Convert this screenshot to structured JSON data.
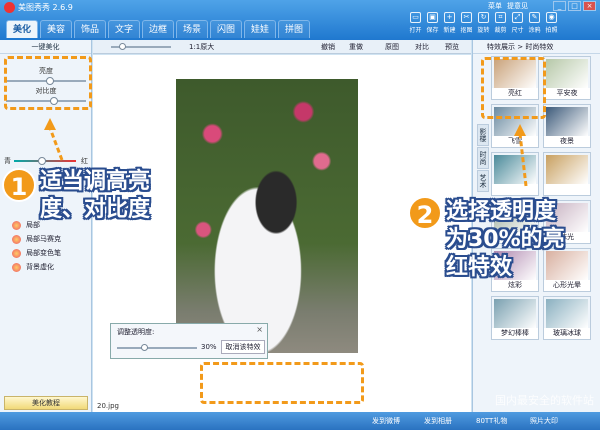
{
  "app": {
    "title": "美图秀秀 2.6.9"
  },
  "top_menu": [
    "菜单",
    "提意见"
  ],
  "window_buttons": [
    "_",
    "□",
    "×"
  ],
  "tabs": [
    "美化",
    "美容",
    "饰品",
    "文字",
    "边框",
    "场景",
    "闪图",
    "娃娃",
    "拼图"
  ],
  "active_tab": "美化",
  "tools": [
    "打开",
    "保存",
    "新建",
    "抠图",
    "旋转",
    "裁剪",
    "尺寸",
    "涂鸦",
    "拍照"
  ],
  "left_panel": {
    "header": "一键美化",
    "brightness_label": "亮度",
    "contrast_label": "对比度",
    "color_left": "青",
    "color_right": "红",
    "fx_items": [
      "局部",
      "局部马赛克",
      "局部变色笔",
      "背景虚化"
    ],
    "tutorial_button": "美化教程"
  },
  "canvas_toolbar": {
    "zoom_label": "1:1原大",
    "undo": "撤销",
    "redo": "重做",
    "original": "原图",
    "compare": "对比",
    "preview": "预览"
  },
  "file_name": "20.jpg",
  "opacity_dialog": {
    "label": "调整透明度:",
    "value": "30%",
    "value_number": 30,
    "cancel_button": "取消该特效",
    "close": "×"
  },
  "right_panel": {
    "header": "特效展示 > 时尚特效",
    "side_tabs": [
      "影楼",
      "时尚",
      "艺术"
    ],
    "thumbnails": [
      {
        "label": "亮红",
        "color": "#c9a27a"
      },
      {
        "label": "平安夜",
        "color": "#b6c8a8"
      },
      {
        "label": "飞雪",
        "color": "#6a8aa0"
      },
      {
        "label": "夜景",
        "color": "#3c5a7a"
      },
      {
        "label": "",
        "color": "#4a8a9a"
      },
      {
        "label": "",
        "color": "#c8a060"
      },
      {
        "label": "",
        "color": "#a0b0a0"
      },
      {
        "label": "抹光",
        "color": "#c6b0c0"
      },
      {
        "label": "炫彩",
        "color": "#b08ab0"
      },
      {
        "label": "心形光晕",
        "color": "#d8b0a0"
      },
      {
        "label": "梦幻棒棒",
        "color": "#7aa0b0"
      },
      {
        "label": "玻璃冰球",
        "color": "#8ab0c0"
      }
    ]
  },
  "status_bar": [
    "发到微博",
    "发到相册",
    "80TT礼物",
    "照片大印"
  ],
  "annotations": {
    "step1_number": "1",
    "step1_text_line1": "适当调高亮",
    "step1_text_line2": "度、对比度",
    "step2_number": "2",
    "step2_text_line1": "选择透明度",
    "step2_text_line2": "为30%的亮",
    "step2_text_line3": "红特效",
    "watermark": "国内最安全的软件站"
  },
  "colors": {
    "accent_orange": "#f29a1a",
    "title_blue": "#1f78cf"
  }
}
